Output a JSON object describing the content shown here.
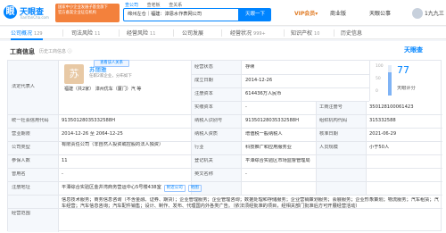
{
  "header": {
    "logo_text": "天眼查",
    "logo_url": "TianYanCha.com",
    "promo_line1": "国家中小企业发展子基金旗下",
    "promo_line2": "官方备案企业征信机构",
    "search_tabs": [
      "查公司",
      "查老板",
      "查关系"
    ],
    "search_value": "绵州左仓｜福建：漳恩水作表网公司",
    "search_button": "天眼一下",
    "vip": "VIP会员",
    "vip_arrow": "▾",
    "business": "商业版",
    "service": "天眼公事",
    "user": "1九九三"
  },
  "tabs": [
    {
      "label": "公司概况",
      "count": "129",
      "active": true
    },
    {
      "label": "司法风险",
      "count": "11",
      "active": false
    },
    {
      "label": "经营风险",
      "count": "11",
      "active": false
    },
    {
      "label": "公司发展",
      "count": "",
      "active": false
    },
    {
      "label": "经营状况",
      "count": "999+",
      "active": false
    },
    {
      "label": "知识产权",
      "count": "10",
      "active": false
    },
    {
      "label": "历史信息",
      "count": "",
      "active": false
    }
  ],
  "section": {
    "title": "工商信息",
    "history": "历史工商信息 ⓘ",
    "brand": "天眼查"
  },
  "legal": {
    "label": "法定代表人",
    "avatar_char": "苏",
    "name": "苏丽雅",
    "follow": "查看该人关系",
    "tags": "任职2家企业，分布如下",
    "group": "福建（共2家）    漳州优车（厦门）汽   等"
  },
  "info": {
    "status_label": "经营状态",
    "status_value": "存续",
    "date_label": "成立日期",
    "date_value": "2014-12-26",
    "cap_label": "注册资本",
    "cap_value": "614436万人民币",
    "paid_label": "实缴资本",
    "paid_value": "-",
    "credit_label": "统一社会信用代码",
    "credit_value": "91350128035332588H",
    "taxid_label": "纳税人识别号",
    "taxid_value": "91350128035332588H",
    "org_label": "组织机构代码",
    "org_value": "315332588",
    "term_label": "营业期限",
    "term_value": "2014-12-26  至 2064-12-25",
    "taxpayer_label": "纳税人资质",
    "taxpayer_value": "增值税一般纳税人",
    "approve_label": "核准日期",
    "approve_value": "2021-06-29",
    "type_label": "公司类型",
    "type_value": "有限责任公司（非自然人投资或控股的法人独资）",
    "industry_label": "行业",
    "industry_value": "科技推广和应用服务业",
    "staff_label": "人员规模",
    "staff_value": "小于50人",
    "insured_label": "参保人数",
    "insured_value": "11",
    "authority_label": "登记机关",
    "authority_value": "平潭综合实验区市场监督管理局",
    "former_label": "曾用名",
    "former_value": "-",
    "english_label": "英文名称",
    "english_value": "-",
    "address_label": "注册地址",
    "address_value": "平潭综合实验区金井湾商务营运中心5号楼438室",
    "address_chip1": "附近公司",
    "address_chip2": "地图",
    "scope_label": "经营范围",
    "scope_value": "信息技术服务；商务信息咨询（不含金融、证券、期货）；企业管理服务；企业管理咨询；数据处理和存储服务；企业营销策划服务；会展服务；企业形象策划；物流服务",
    "scope_value2": "；汽车租赁；汽车经营；汽车信息咨询；汽车配件销售；设计、制作、发布、代理国内外各类广告。（依法须经批准的项目，经相关部门批准后方可开展经营活动）"
  },
  "score": {
    "label": "天眼评分",
    "value": "77",
    "reg_no_label": "工商注册号",
    "reg_no_value": "350128100061423",
    "axis_top": "100",
    "axis_mid": "50",
    "axis_bot": "0"
  },
  "colors": {
    "accent": "#0084ff",
    "promo": "#f3813c",
    "vip": "#e07b24"
  }
}
